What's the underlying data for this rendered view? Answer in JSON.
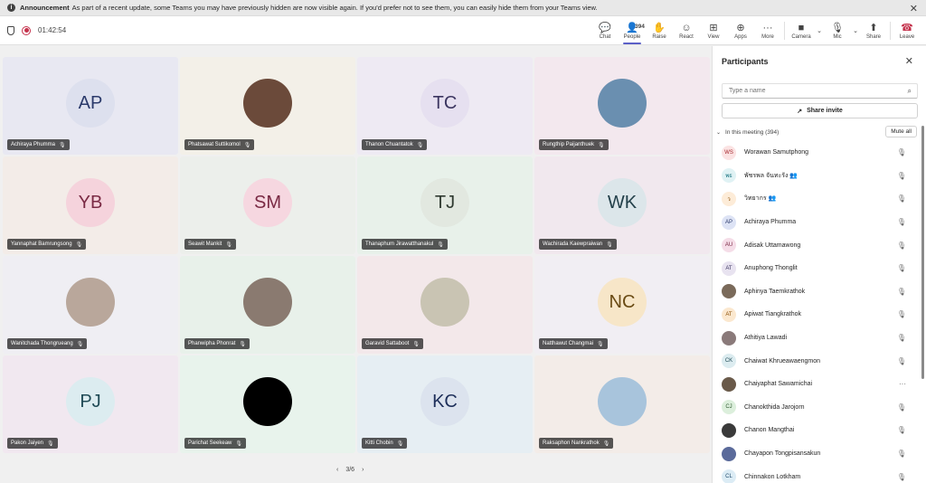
{
  "announcement": {
    "label": "Announcement",
    "text": "As part of a recent update, some Teams you may have previously hidden are now visible again. If you'd prefer not to see them, you can easily hide them from your Teams view."
  },
  "toolbar": {
    "timer": "01:42:54",
    "people_count": "394",
    "buttons": {
      "chat": "Chat",
      "people": "People",
      "raise": "Raise",
      "react": "React",
      "view": "View",
      "apps": "Apps",
      "more": "More",
      "camera": "Camera",
      "mic": "Mic",
      "share": "Share",
      "leave": "Leave"
    }
  },
  "tiles": [
    {
      "initials": "AP",
      "name": "Achiraya Phumma",
      "bg": "#e8e8f2",
      "avbg": "#dde0ee",
      "avfg": "#2b3a6b"
    },
    {
      "initials": "",
      "name": "Phatsawat Suttikomol",
      "bg": "#f3f0e8",
      "avbg": "#6b4a3a",
      "avfg": "#fff"
    },
    {
      "initials": "TC",
      "name": "Thanon Chuantatok",
      "bg": "#eeeaf3",
      "avbg": "#e6e0f0",
      "avfg": "#3b3560"
    },
    {
      "initials": "",
      "name": "Rungthip Paijanthuek",
      "bg": "#f3e8ee",
      "avbg": "#6a8fb0",
      "avfg": "#fff"
    },
    {
      "initials": "YB",
      "name": "Yannaphat Bamrungsong",
      "bg": "#f3ece8",
      "avbg": "#f5d3dc",
      "avfg": "#7a2a44"
    },
    {
      "initials": "SM",
      "name": "Seawit Mankit",
      "bg": "#ecefeb",
      "avbg": "#f6d7e0",
      "avfg": "#7a2a44"
    },
    {
      "initials": "TJ",
      "name": "Thanaphum Jirawatthanakul",
      "bg": "#e8f1ea",
      "avbg": "#e2e8e0",
      "avfg": "#2f3a30"
    },
    {
      "initials": "WK",
      "name": "Wachirada Kaewpraiwan",
      "bg": "#f1e8ee",
      "avbg": "#dce6ea",
      "avfg": "#23404a"
    },
    {
      "initials": "",
      "name": "Wanitchada Thongrueang",
      "bg": "#efeef3",
      "avbg": "#b9a79b",
      "avfg": "#fff"
    },
    {
      "initials": "",
      "name": "Phanwipha Phonrat",
      "bg": "#e8f1ea",
      "avbg": "#8a7a70",
      "avfg": "#fff"
    },
    {
      "initials": "",
      "name": "Garavid Sattaboot",
      "bg": "#f3e8ea",
      "avbg": "#c9c4b3",
      "avfg": "#fff"
    },
    {
      "initials": "NC",
      "name": "Natthawut Changmai",
      "bg": "#f1eef3",
      "avbg": "#f7e6c8",
      "avfg": "#6a4b14"
    },
    {
      "initials": "PJ",
      "name": "Pakon Jaiyen",
      "bg": "#f1e8f0",
      "avbg": "#dcecf0",
      "avfg": "#1f4a55"
    },
    {
      "initials": "",
      "name": "Parichat Seekeaw",
      "bg": "#e8f3ec",
      "avbg": "#000000",
      "avfg": "#fff"
    },
    {
      "initials": "KC",
      "name": "Kitti Chobin",
      "bg": "#e6eef3",
      "avbg": "#dce3ee",
      "avfg": "#1e2f5a"
    },
    {
      "initials": "",
      "name": "Raksaphon Nankrathok",
      "bg": "#f3ece8",
      "avbg": "#a8c4dc",
      "avfg": "#fff"
    }
  ],
  "pager": {
    "label": "3/6"
  },
  "panel": {
    "title": "Participants",
    "search_placeholder": "Type a name",
    "share_invite": "Share invite",
    "section_label": "In this meeting (394)",
    "mute_all": "Mute all",
    "participants": [
      {
        "initials": "WS",
        "name": "Worawan Samutphong",
        "bg": "#fbe3e3",
        "fg": "#a4262c",
        "icon": "mic-off"
      },
      {
        "initials": "พธ",
        "name": "พัชรพล จันทะรัง 👥",
        "bg": "#e0f2f4",
        "fg": "#0b6a78",
        "icon": "mic-off"
      },
      {
        "initials": "ว",
        "name": "วิทยากร 👥",
        "bg": "#fdecd8",
        "fg": "#8a4b00",
        "icon": "mic-off"
      },
      {
        "initials": "AP",
        "name": "Achiraya Phumma",
        "bg": "#dde3f5",
        "fg": "#2b3a6b",
        "icon": "mic-off"
      },
      {
        "initials": "AU",
        "name": "Adisak Uttamawong",
        "bg": "#f5dde8",
        "fg": "#7a2a44",
        "icon": "mic-off"
      },
      {
        "initials": "AT",
        "name": "Anuphong Thonglit",
        "bg": "#e8e3f0",
        "fg": "#3b3560",
        "icon": "mic-off"
      },
      {
        "initials": "",
        "name": "Aphinya Taemkrathok",
        "bg": "#7a6a5a",
        "fg": "#fff",
        "icon": "mic-off"
      },
      {
        "initials": "AT",
        "name": "Apiwat Tiangkrathok",
        "bg": "#fbe8cf",
        "fg": "#8a4b00",
        "icon": "mic-off"
      },
      {
        "initials": "",
        "name": "Athitiya Lawadi",
        "bg": "#8a7a7a",
        "fg": "#fff",
        "icon": "mic-off"
      },
      {
        "initials": "CK",
        "name": "Chaiwat Khrueawaengmon",
        "bg": "#dcecf0",
        "fg": "#1f4a55",
        "icon": "mic-off"
      },
      {
        "initials": "",
        "name": "Chaiyaphat Sawamichai",
        "bg": "#6a5a4a",
        "fg": "#fff",
        "icon": "more"
      },
      {
        "initials": "CJ",
        "name": "Chanokthida Jarojorn",
        "bg": "#dcefdc",
        "fg": "#2f5a30",
        "icon": "mic-off"
      },
      {
        "initials": "",
        "name": "Chanon Mangthai",
        "bg": "#3a3a3a",
        "fg": "#fff",
        "icon": "mic-off"
      },
      {
        "initials": "",
        "name": "Chayapon Tongpisansakun",
        "bg": "#5a6a9a",
        "fg": "#fff",
        "icon": "mic-off"
      },
      {
        "initials": "CL",
        "name": "Chinnakon Lotkham",
        "bg": "#dcecf5",
        "fg": "#1f4a6b",
        "icon": "mic-off"
      }
    ]
  }
}
